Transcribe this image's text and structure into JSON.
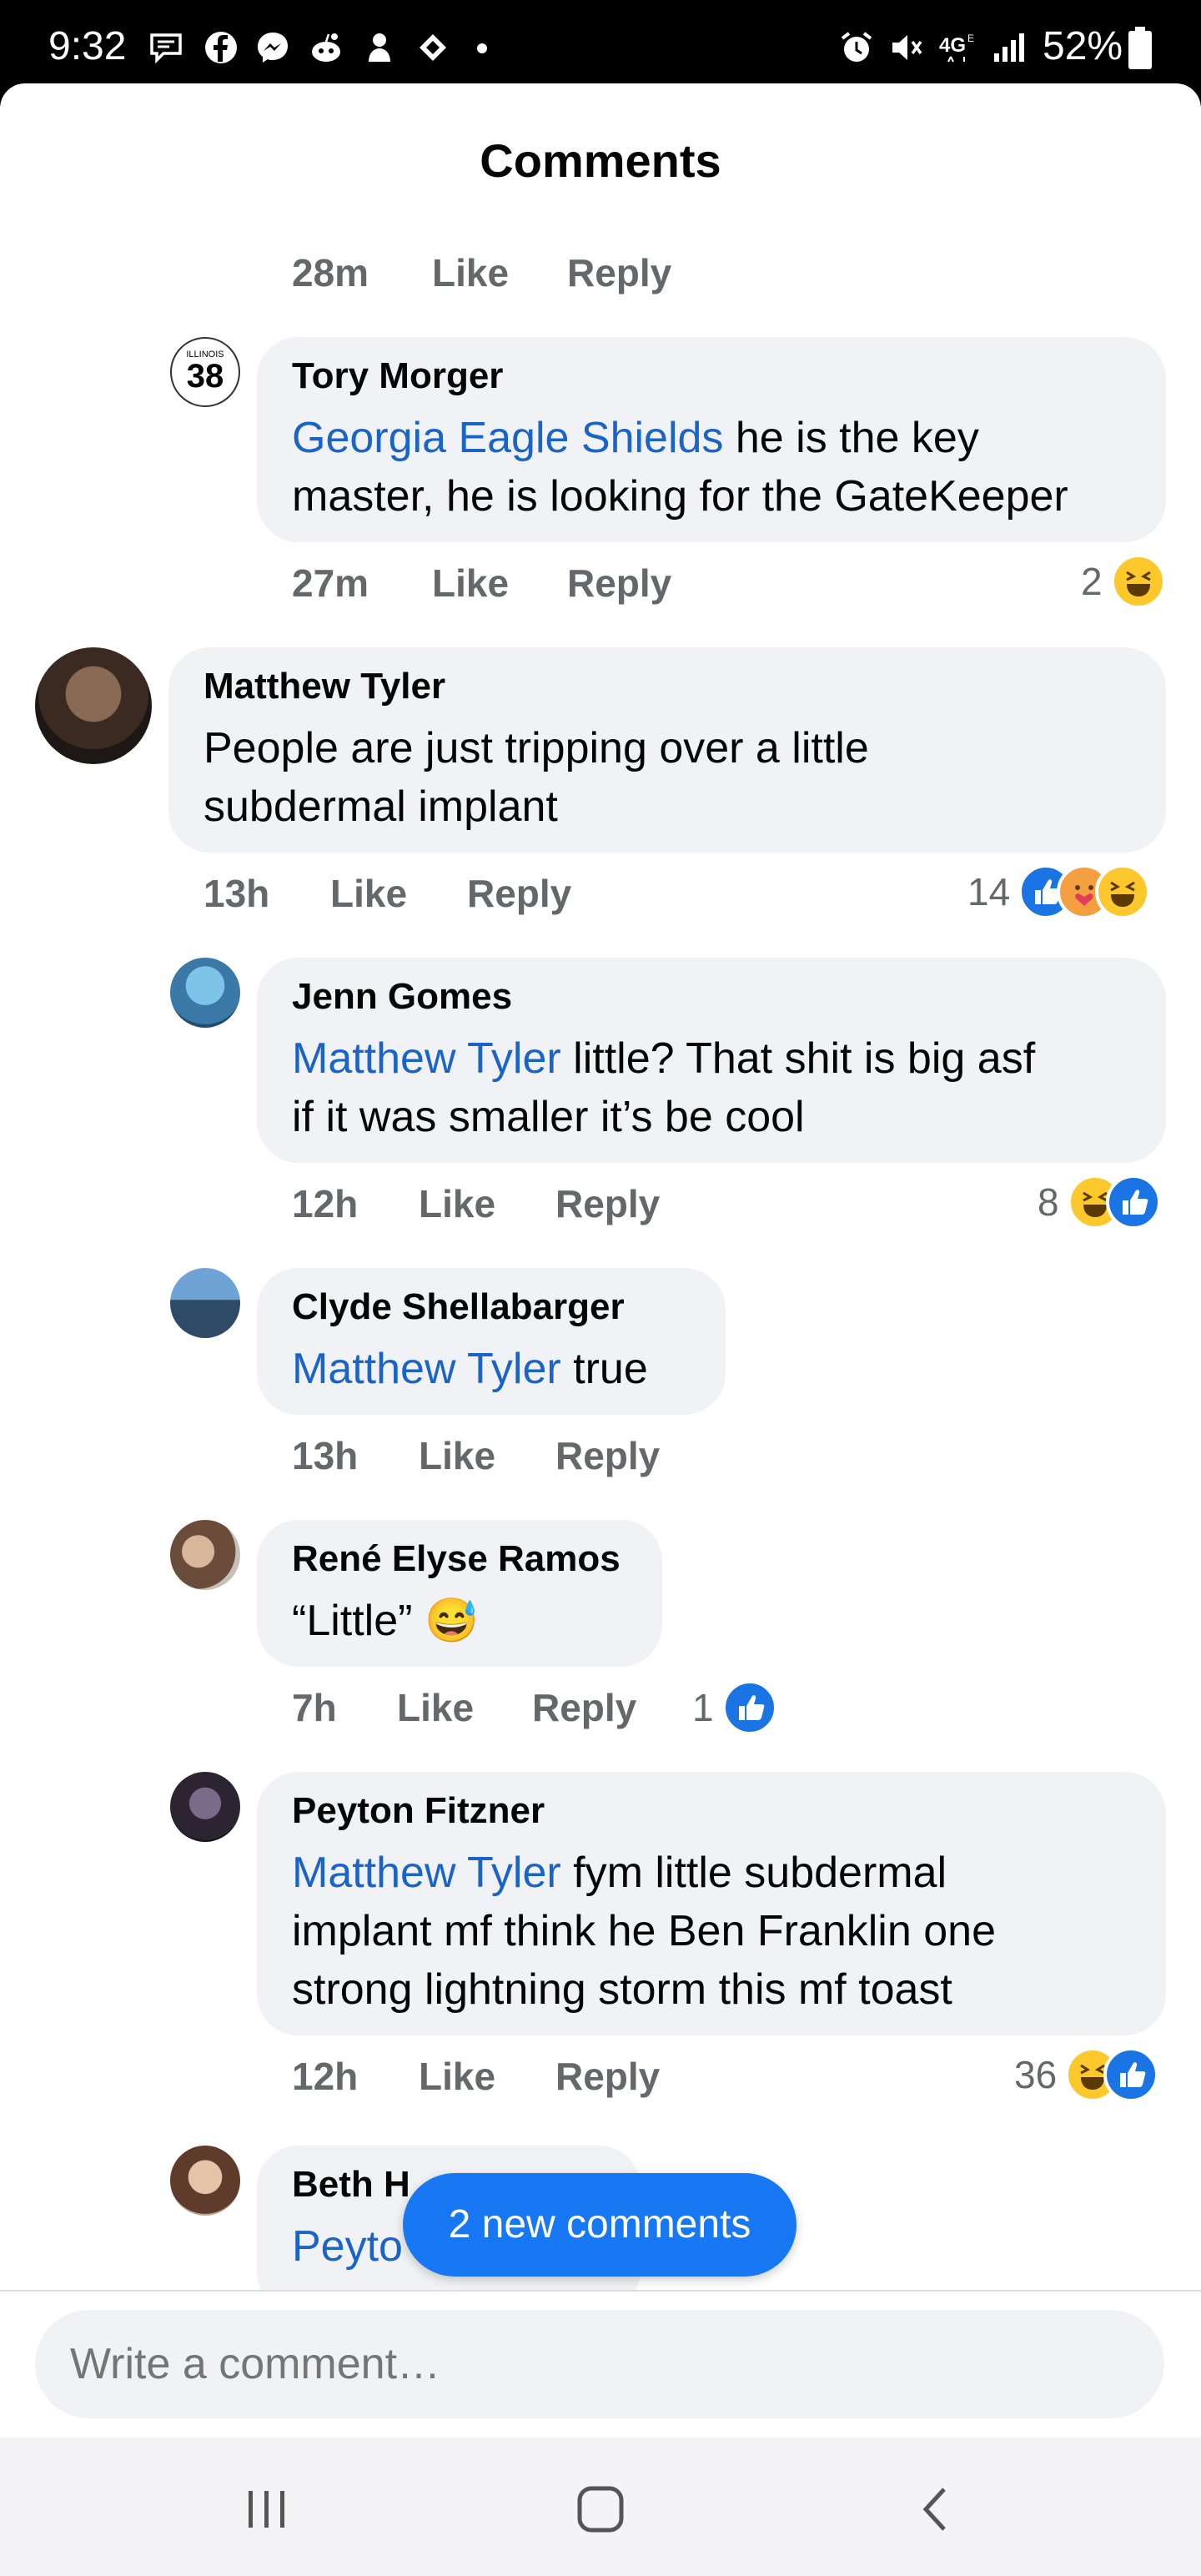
{
  "status_bar": {
    "time": "9:32",
    "battery": "52%",
    "left_icons": [
      "messages-icon",
      "facebook-icon",
      "messenger-icon",
      "reddit-icon",
      "app-icon",
      "app-icon-2"
    ],
    "right_icons": [
      "alarm-icon",
      "mute-icon",
      "lte-icon",
      "signal-icon",
      "battery-icon"
    ]
  },
  "header": {
    "title": "Comments"
  },
  "top_meta": {
    "time": "28m",
    "like": "Like",
    "reply": "Reply"
  },
  "comments": [
    {
      "author": "Tory Morger",
      "mention": "Georgia Eagle Shields",
      "line1_rest": " he is the key",
      "line2": "master, he is looking for the GateKeeper",
      "time": "27m",
      "like": "Like",
      "reply": "Reply",
      "reaction_count": "2",
      "avatar_text": "ILLINOIS",
      "avatar_num": "38"
    },
    {
      "author": "Matthew Tyler",
      "line1": "People are just tripping over a little",
      "line2": "subdermal implant",
      "time": "13h",
      "like": "Like",
      "reply": "Reply",
      "reaction_count": "14"
    },
    {
      "author": "Jenn Gomes",
      "mention": "Matthew Tyler",
      "line1_rest": " little? That shit is big asf",
      "line2": "if it was smaller it’s be cool",
      "time": "12h",
      "like": "Like",
      "reply": "Reply",
      "reaction_count": "8"
    },
    {
      "author": "Clyde Shellabarger",
      "mention": "Matthew Tyler",
      "line1_rest": " true",
      "time": "13h",
      "like": "Like",
      "reply": "Reply"
    },
    {
      "author": "René Elyse Ramos",
      "line1": "“Little”",
      "emoji": "😅",
      "time": "7h",
      "like": "Like",
      "reply": "Reply",
      "reaction_count": "1"
    },
    {
      "author": "Peyton Fitzner",
      "mention": "Matthew Tyler",
      "line1_rest": " fym little subdermal",
      "line2": "implant mf think he Ben Franklin one",
      "line3": "strong lightning storm this mf toast",
      "time": "12h",
      "like": "Like",
      "reply": "Reply",
      "reaction_count": "36"
    },
    {
      "author": "Beth H",
      "mention": "Peyto"
    }
  ],
  "new_comments_button": "2 new comments",
  "composer": {
    "placeholder": "Write a comment…"
  },
  "colors": {
    "accent": "#1877f2",
    "mention": "#1b64c7",
    "bubble": "#f0f2f5",
    "meta": "#65676b"
  }
}
